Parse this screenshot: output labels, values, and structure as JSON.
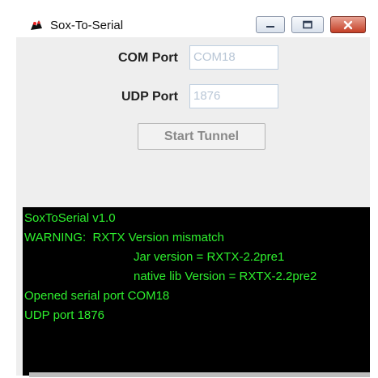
{
  "window": {
    "title": "Sox-To-Serial",
    "controls": {
      "minimize": "minimize",
      "maximize": "maximize",
      "close": "close"
    }
  },
  "form": {
    "com_port": {
      "label": "COM Port",
      "value": "COM18"
    },
    "udp_port": {
      "label": "UDP Port",
      "value": "1876"
    },
    "start_button": {
      "label": "Start Tunnel",
      "enabled": false
    }
  },
  "console": {
    "lines": [
      "SoxToSerial v1.0",
      "WARNING:  RXTX Version mismatch",
      "Jar version = RXTX-2.2pre1",
      "native lib Version = RXTX-2.2pre2",
      "Opened serial port COM18",
      "UDP port 1876"
    ],
    "text_color": "#2ef02e",
    "background": "#000000"
  }
}
